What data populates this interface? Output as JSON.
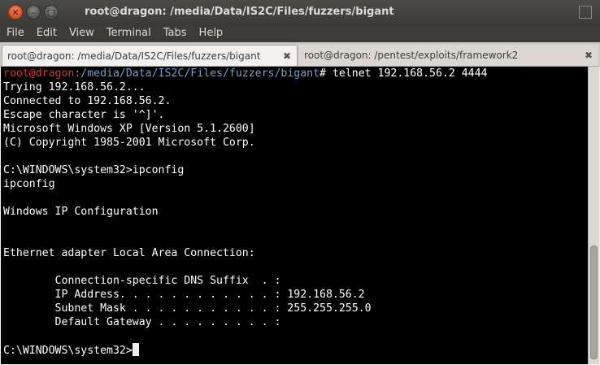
{
  "window": {
    "title": "root@dragon: /media/Data/IS2C/Files/fuzzers/bigant",
    "controls": {
      "close": "✕",
      "minimize": "–",
      "maximize": "□"
    }
  },
  "menu": [
    "File",
    "Edit",
    "View",
    "Terminal",
    "Tabs",
    "Help"
  ],
  "tabs": [
    {
      "label": "root@dragon: /media/Data/IS2C/Files/fuzzers/bigant",
      "active": true,
      "close": "✖"
    },
    {
      "label": "root@dragon: /pentest/exploits/framework2",
      "active": false,
      "close": "✖"
    }
  ],
  "terminal": {
    "colors": {
      "background": "#000000",
      "text": "#ffffff",
      "prompt_user": "#ef2929",
      "prompt_path": "#729fcf"
    },
    "prompt": {
      "user": "root@dragon",
      "path": ":/media/Data/IS2C/Files/fuzzers/bigant",
      "symbol": "# ",
      "command": "telnet 192.168.56.2 4444"
    },
    "lines": [
      "Trying 192.168.56.2...",
      "Connected to 192.168.56.2.",
      "Escape character is '^]'.",
      "Microsoft Windows XP [Version 5.1.2600]",
      "(C) Copyright 1985-2001 Microsoft Corp.",
      "",
      "C:\\WINDOWS\\system32>ipconfig",
      "ipconfig",
      "",
      "Windows IP Configuration",
      "",
      "",
      "Ethernet adapter Local Area Connection:",
      "",
      "        Connection-specific DNS Suffix  . :",
      "        IP Address. . . . . . . . . . . . : 192.168.56.2",
      "        Subnet Mask . . . . . . . . . . . : 255.255.255.0",
      "        Default Gateway . . . . . . . . . :",
      ""
    ],
    "current_prompt": "C:\\WINDOWS\\system32>"
  }
}
